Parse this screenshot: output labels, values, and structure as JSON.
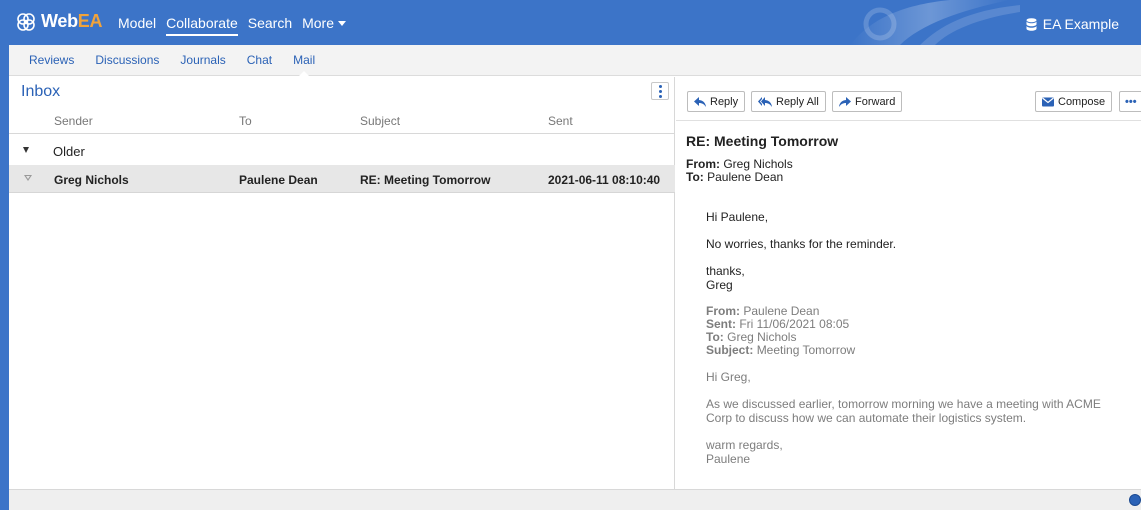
{
  "app": {
    "logo_prefix": "Web",
    "logo_suffix": "EA",
    "model_name": "EA Example"
  },
  "topnav": {
    "items": [
      "Model",
      "Collaborate",
      "Search",
      "More"
    ],
    "active": "Collaborate"
  },
  "subtabs": {
    "items": [
      "Reviews",
      "Discussions",
      "Journals",
      "Chat",
      "Mail"
    ],
    "active": "Mail"
  },
  "inbox": {
    "title": "Inbox",
    "columns": [
      "Sender",
      "To",
      "Subject",
      "Sent"
    ],
    "group_label": "Older",
    "rows": [
      {
        "sender": "Greg Nichols",
        "to": "Paulene Dean",
        "subject": "RE: Meeting Tomorrow",
        "sent": "2021-06-11 08:10:40"
      }
    ]
  },
  "toolbar": {
    "reply": "Reply",
    "reply_all": "Reply All",
    "forward": "Forward",
    "compose": "Compose",
    "more": "•••"
  },
  "message": {
    "subject": "RE: Meeting Tomorrow",
    "from_label": "From:",
    "from": "Greg Nichols",
    "to_label": "To:",
    "to": "Paulene Dean",
    "greeting": "Hi Paulene,",
    "line1": "No worries, thanks for the reminder.",
    "signoff": "thanks,",
    "signature": "Greg",
    "quoted": {
      "from_label": "From:",
      "from": "Paulene Dean",
      "sent_label": "Sent:",
      "sent": "Fri 11/06/2021 08:05",
      "to_label": "To:",
      "to": "Greg Nichols",
      "subject_label": "Subject:",
      "subject": "Meeting Tomorrow",
      "greeting": "Hi Greg,",
      "body1": "As we discussed earlier, tomorrow morning we have a meeting with ACME",
      "body2": "Corp to discuss how we can automate their logistics system.",
      "signoff": "warm regards,",
      "signature": "Paulene"
    }
  },
  "colors": {
    "brand_blue": "#3c74c8",
    "link_blue": "#2b62b6",
    "logo_accent": "#f2a33a"
  },
  "icons": [
    "webea-logo-icon",
    "database-icon",
    "reply-icon",
    "reply-all-icon",
    "forward-icon",
    "envelope-icon",
    "kebab-menu-icon",
    "status-icon"
  ]
}
